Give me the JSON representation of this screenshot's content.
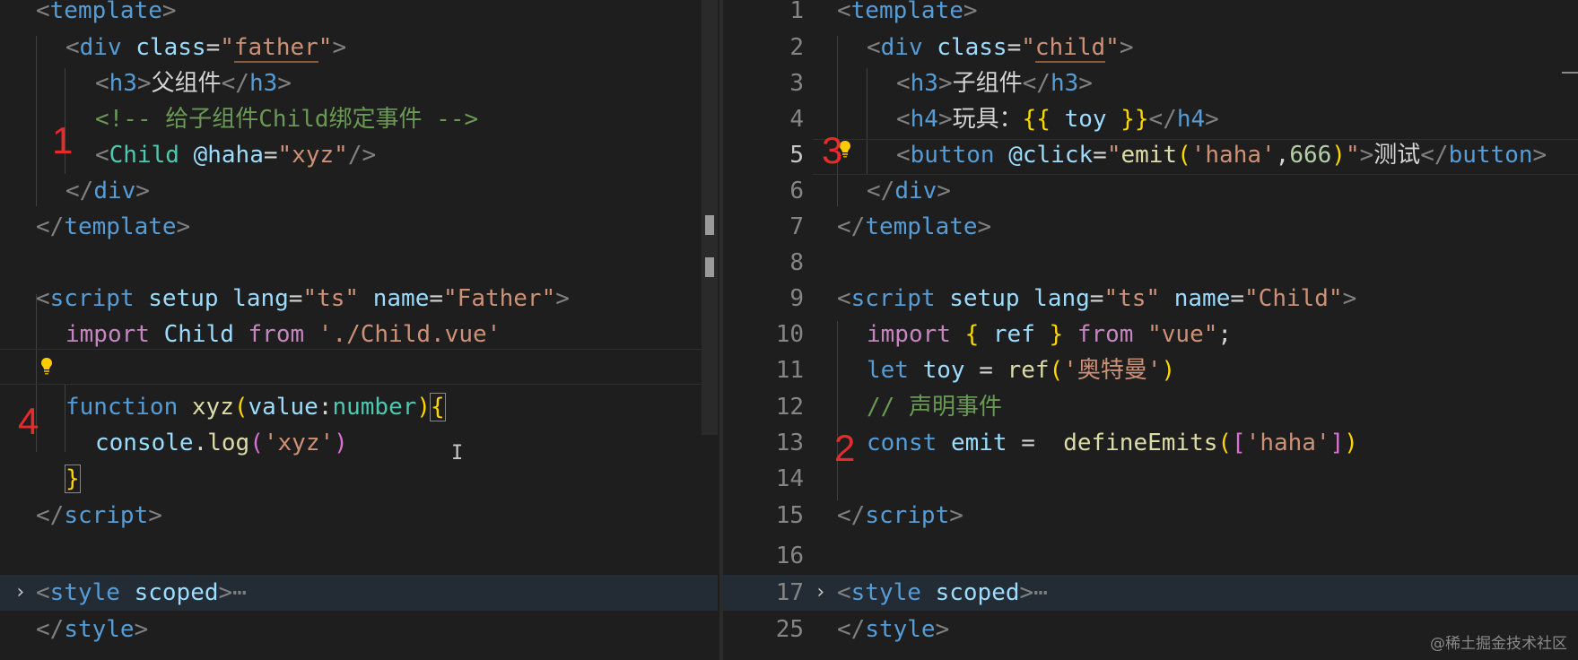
{
  "left": {
    "lines": {
      "l0": {
        "open": "<",
        "tag": "template",
        "close": ">"
      },
      "l1": {
        "open": "<",
        "tag": "div",
        "sp": " ",
        "attr": "class",
        "eq": "=",
        "q1": "\"",
        "val": "father",
        "q2": "\"",
        "close": ">"
      },
      "l2": {
        "open": "<",
        "tag": "h3",
        "close": ">",
        "text": "父组件",
        "open2": "</",
        "tag2": "h3",
        "close2": ">"
      },
      "l3": {
        "comment": "<!-- 给子组件Child绑定事件 -->"
      },
      "l4": {
        "open": "<",
        "tag": "Child",
        "sp": " ",
        "attr": "@haha",
        "eq": "=",
        "val": "\"xyz\"",
        "close": "/>"
      },
      "l5": {
        "open": "</",
        "tag": "div",
        "close": ">"
      },
      "l6": {
        "open": "</",
        "tag": "template",
        "close": ">"
      },
      "l8": {
        "open": "<",
        "tag": "script",
        "a1": "setup",
        "a2": "lang",
        "eq1": "=",
        "v1": "\"ts\"",
        "a3": "name",
        "eq2": "=",
        "v2": "\"Father\"",
        "close": ">"
      },
      "l9": {
        "kw": "import",
        "id": "Child",
        "from": "from",
        "str": "'./Child.vue'"
      },
      "l11": {
        "kw": "function",
        "fn": "xyz",
        "p1": "(",
        "param": "value",
        "colon": ":",
        "type": "number",
        "p2": ")",
        "brace": "{"
      },
      "l12": {
        "obj": "console",
        "dot": ".",
        "fn": "log",
        "p1": "(",
        "str": "'xyz'",
        "p2": ")"
      },
      "l13": {
        "brace": "}"
      },
      "l14": {
        "open": "</",
        "tag": "script",
        "close": ">"
      },
      "l16": {
        "open": "<",
        "tag": "style",
        "attr": "scoped",
        "close": ">",
        "ellipsis": "⋯"
      },
      "l17": {
        "open": "</",
        "tag": "style",
        "close": ">"
      }
    },
    "annotations": {
      "a1": "1",
      "a4": "4"
    }
  },
  "right": {
    "line_numbers": [
      "1",
      "2",
      "3",
      "4",
      "5",
      "6",
      "7",
      "8",
      "9",
      "10",
      "11",
      "12",
      "13",
      "14",
      "15",
      "16",
      "17",
      "25"
    ],
    "lines": {
      "l1": {
        "open": "<",
        "tag": "template",
        "close": ">"
      },
      "l2": {
        "open": "<",
        "tag": "div",
        "attr": "class",
        "eq": "=",
        "q1": "\"",
        "val": "child",
        "q2": "\"",
        "close": ">"
      },
      "l3": {
        "open": "<",
        "tag": "h3",
        "close": ">",
        "text": "子组件",
        "open2": "</",
        "tag2": "h3",
        "close2": ">"
      },
      "l4": {
        "open": "<",
        "tag": "h4",
        "close": ">",
        "text": "玩具：",
        "mo": "{{",
        "var": " toy ",
        "mc": "}}",
        "open2": "</",
        "tag2": "h4",
        "close2": ">"
      },
      "l5": {
        "open": "<",
        "tag": "button",
        "attr": "@click",
        "eq": "=",
        "q1": "\"",
        "fn": "emit",
        "p1": "(",
        "s1": "'haha'",
        "comma": ",",
        "num": "666",
        "p2": ")",
        "q2": "\"",
        "close": ">",
        "text": "测试",
        "open2": "</",
        "tag2": "button",
        "close2": ">"
      },
      "l6": {
        "open": "</",
        "tag": "div",
        "close": ">"
      },
      "l7": {
        "open": "</",
        "tag": "template",
        "close": ">"
      },
      "l9": {
        "open": "<",
        "tag": "script",
        "a1": "setup",
        "a2": "lang",
        "eq1": "=",
        "v1": "\"ts\"",
        "a3": "name",
        "eq2": "=",
        "v2": "\"Child\"",
        "close": ">"
      },
      "l10": {
        "kw": "import",
        "b1": "{",
        "id": " ref ",
        "b2": "}",
        "from": "from",
        "str": "\"vue\"",
        "semi": ";"
      },
      "l11": {
        "kw": "let",
        "var": "toy",
        "eq": " = ",
        "fn": "ref",
        "p1": "(",
        "str": "'奥特曼'",
        "p2": ")"
      },
      "l12": {
        "comment": "// 声明事件"
      },
      "l13": {
        "kw": "const",
        "var": "emit",
        "eq": " =  ",
        "fn": "defineEmits",
        "p1": "(",
        "b1": "[",
        "str": "'haha'",
        "b2": "]",
        "p2": ")"
      },
      "l15": {
        "open": "</",
        "tag": "script",
        "close": ">"
      },
      "l17": {
        "open": "<",
        "tag": "style",
        "attr": "scoped",
        "close": ">",
        "ellipsis": "⋯"
      },
      "l25": {
        "open": "</",
        "tag": "style",
        "close": ">"
      }
    },
    "annotations": {
      "a2": "2",
      "a3": "3"
    }
  },
  "fold_chevron": "›",
  "ibeam": "I",
  "watermark": "@稀土掘金技术社区",
  "colors": {
    "background": "#1e1e1e",
    "annotation_red": "#e52b2b",
    "tag_blue": "#569cd6",
    "string_orange": "#ce9178",
    "comment_green": "#6a9955",
    "bracket_gold": "#ffd700"
  }
}
